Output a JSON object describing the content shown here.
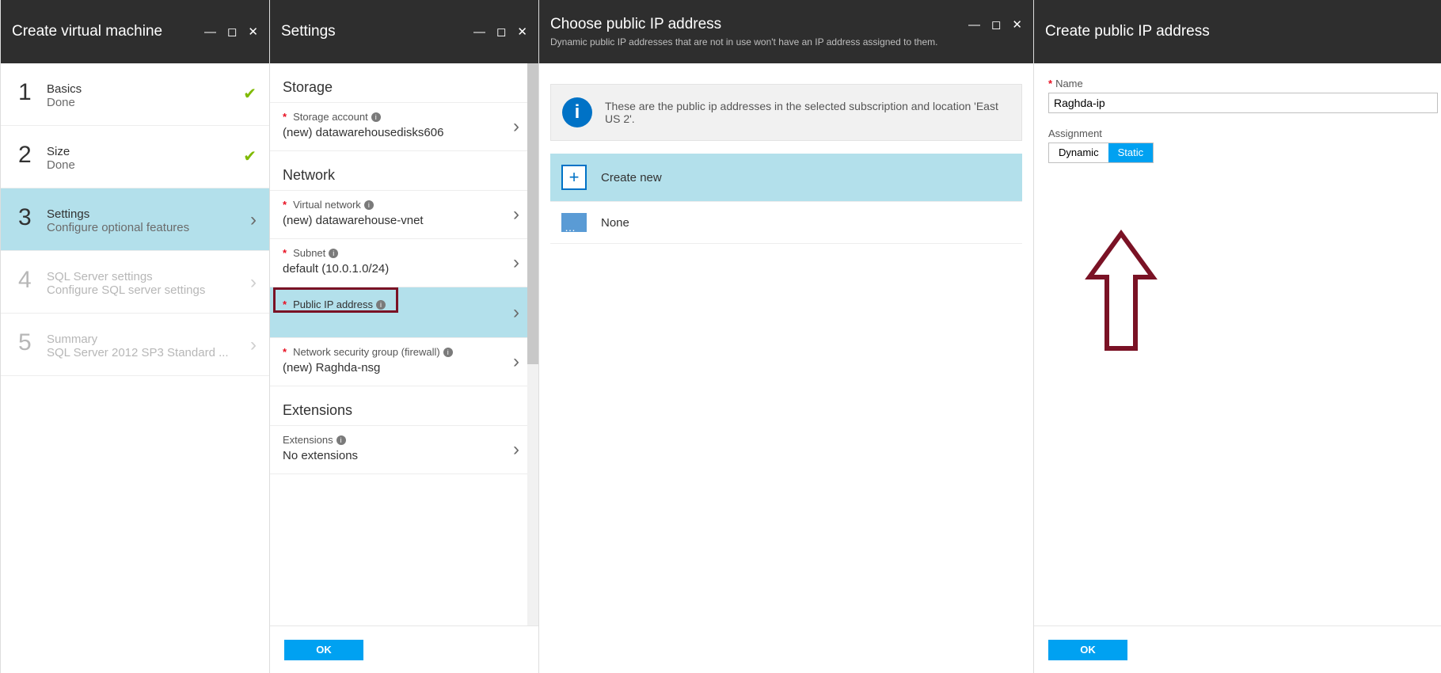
{
  "blade_vm": {
    "title": "Create virtual machine",
    "steps": [
      {
        "num": "1",
        "title": "Basics",
        "subtitle": "Done",
        "state": "done"
      },
      {
        "num": "2",
        "title": "Size",
        "subtitle": "Done",
        "state": "done"
      },
      {
        "num": "3",
        "title": "Settings",
        "subtitle": "Configure optional features",
        "state": "active"
      },
      {
        "num": "4",
        "title": "SQL Server settings",
        "subtitle": "Configure SQL server settings",
        "state": "disabled"
      },
      {
        "num": "5",
        "title": "Summary",
        "subtitle": "SQL Server 2012 SP3 Standard ...",
        "state": "disabled"
      }
    ]
  },
  "blade_settings": {
    "title": "Settings",
    "section_storage": "Storage",
    "section_network": "Network",
    "section_extensions": "Extensions",
    "storage_account": {
      "label": "Storage account",
      "value": "(new) datawarehousedisks606"
    },
    "virtual_network": {
      "label": "Virtual network",
      "value": "(new) datawarehouse-vnet"
    },
    "subnet": {
      "label": "Subnet",
      "value": "default (10.0.1.0/24)"
    },
    "public_ip": {
      "label": "Public IP address",
      "value": ""
    },
    "nsg": {
      "label": "Network security group (firewall)",
      "value": "(new) Raghda-nsg"
    },
    "extensions": {
      "label": "Extensions",
      "value": "No extensions"
    },
    "ok_label": "OK"
  },
  "blade_choose": {
    "title": "Choose public IP address",
    "subtitle": "Dynamic public IP addresses that are not in use won't have an IP address assigned to them.",
    "info_text": "These are the public ip addresses in the selected subscription and location 'East US 2'.",
    "create_new": "Create new",
    "none": "None"
  },
  "blade_create": {
    "title": "Create public IP address",
    "name_label": "Name",
    "name_value": "Raghda-ip",
    "assignment_label": "Assignment",
    "assign_dynamic": "Dynamic",
    "assign_static": "Static",
    "ok_label": "OK"
  }
}
